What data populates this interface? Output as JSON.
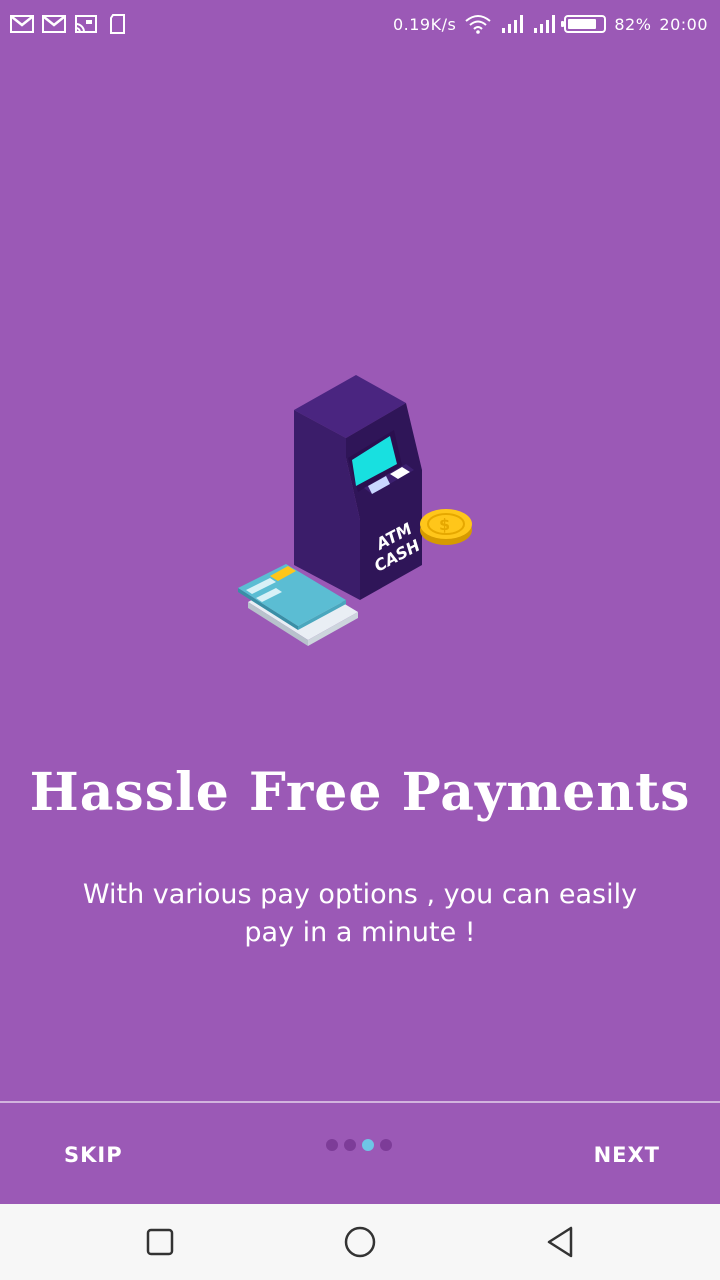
{
  "status_bar": {
    "left_icons": [
      "gmail-icon",
      "gmail-icon",
      "cast-icon",
      "sd-card-icon"
    ],
    "net_speed": "0.19K/s",
    "battery_level": 0.82,
    "battery_text": "82%",
    "time": "20:00"
  },
  "onboarding": {
    "title": "Hassle Free Payments",
    "subtitle": "With various pay options , you can easily pay in a minute !",
    "illustration": {
      "atm_label_line1": "ATM",
      "atm_label_line2": "CASH",
      "coin_symbol": "$"
    },
    "page_count": 4,
    "active_page": 3
  },
  "bottom_bar": {
    "skip_label": "SKIP",
    "next_label": "NEXT"
  },
  "colors": {
    "background": "#9b59b6",
    "dot_inactive": "#7d3c98",
    "dot_active": "#6ec6e6",
    "nav_bar": "#f7f7f7"
  },
  "nav_bar": {
    "buttons": [
      "recents-icon",
      "home-icon",
      "back-icon"
    ]
  }
}
